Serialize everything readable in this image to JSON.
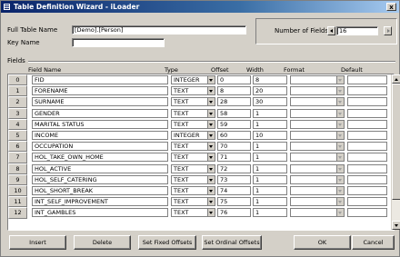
{
  "window": {
    "title": "Table Definition Wizard - iLoader",
    "close_label": "x"
  },
  "form": {
    "full_table_name_label": "Full Table Name",
    "full_table_name_value": "[Demo].[Person]",
    "key_name_label": "Key Name",
    "key_name_value": "",
    "number_of_fields_label": "Number of Fields",
    "number_of_fields_value": "16"
  },
  "fields_section": {
    "label": "Fields",
    "columns": [
      "Field Name",
      "Type",
      "Offset",
      "Width",
      "Format",
      "Default"
    ],
    "rows": [
      {
        "index": "0",
        "name": "FID",
        "type": "INTEGER",
        "offset": "0",
        "width": "8"
      },
      {
        "index": "1",
        "name": "FORENAME",
        "type": "TEXT",
        "offset": "8",
        "width": "20"
      },
      {
        "index": "2",
        "name": "SURNAME",
        "type": "TEXT",
        "offset": "28",
        "width": "30"
      },
      {
        "index": "3",
        "name": "GENDER",
        "type": "TEXT",
        "offset": "58",
        "width": "1"
      },
      {
        "index": "4",
        "name": "MARITAL STATUS",
        "type": "TEXT",
        "offset": "59",
        "width": "1"
      },
      {
        "index": "5",
        "name": "INCOME",
        "type": "INTEGER",
        "offset": "60",
        "width": "10"
      },
      {
        "index": "6",
        "name": "OCCUPATION",
        "type": "TEXT",
        "offset": "70",
        "width": "1"
      },
      {
        "index": "7",
        "name": "HOL_TAKE_OWN_HOME",
        "type": "TEXT",
        "offset": "71",
        "width": "1"
      },
      {
        "index": "8",
        "name": "HOL_ACTIVE",
        "type": "TEXT",
        "offset": "72",
        "width": "1"
      },
      {
        "index": "9",
        "name": "HOL_SELF_CATERING",
        "type": "TEXT",
        "offset": "73",
        "width": "1"
      },
      {
        "index": "10",
        "name": "HOL_SHORT_BREAK",
        "type": "TEXT",
        "offset": "74",
        "width": "1"
      },
      {
        "index": "11",
        "name": "INT_SELF_IMPROVEMENT",
        "type": "TEXT",
        "offset": "75",
        "width": "1"
      },
      {
        "index": "12",
        "name": "INT_GAMBLES",
        "type": "TEXT",
        "offset": "76",
        "width": "1"
      }
    ]
  },
  "buttons": {
    "insert": "Insert",
    "delete": "Delete",
    "set_fixed_offsets": "Set Fixed Offsets",
    "set_ordinal_offsets": "Set Ordinal Offsets",
    "ok": "OK",
    "cancel": "Cancel"
  },
  "colors": {
    "title_start": "#0a246a",
    "title_end": "#a6caf0",
    "face": "#d4d0c8"
  }
}
